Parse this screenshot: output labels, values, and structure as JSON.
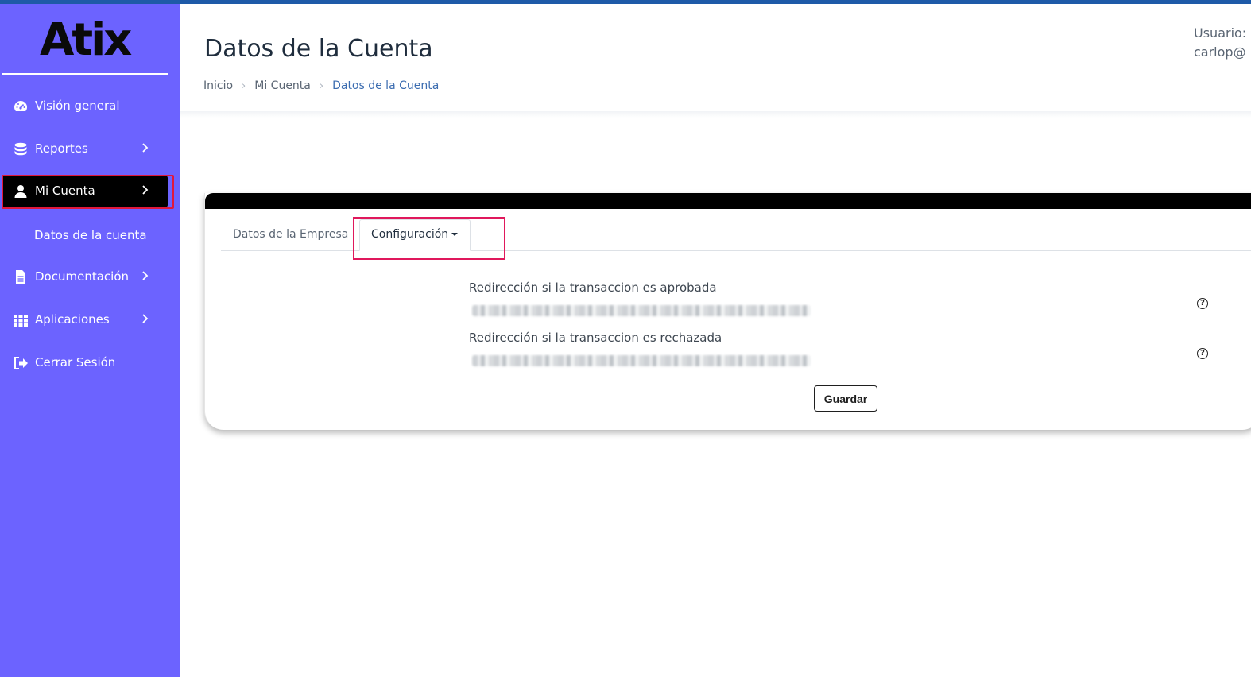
{
  "brand": {
    "logo": "Atix"
  },
  "sidebar": {
    "items": [
      {
        "label": "Visión general",
        "icon": "dashboard-icon"
      },
      {
        "label": "Reportes",
        "icon": "database-icon"
      },
      {
        "label": "Mi Cuenta",
        "icon": "user-icon"
      },
      {
        "label": "Datos de la cuenta"
      },
      {
        "label": "Documentación",
        "icon": "document-icon"
      },
      {
        "label": "Aplicaciones",
        "icon": "grid-icon"
      },
      {
        "label": "Cerrar Sesión",
        "icon": "sign-out-icon"
      }
    ]
  },
  "header": {
    "title": "Datos de la Cuenta",
    "breadcrumb": [
      "Inicio",
      "Mi Cuenta",
      "Datos de la Cuenta"
    ],
    "user_label": "Usuario:",
    "user_email": "carlop@"
  },
  "tabs": [
    {
      "label": "Datos de la Empresa"
    },
    {
      "label": "Configuración"
    }
  ],
  "form": {
    "approved_label": "Redirección si la transaccion es aprobada",
    "rejected_label": "Redirección si la transaccion es rechazada",
    "save_label": "Guardar"
  },
  "colors": {
    "sidebar_bg": "#6c63ff",
    "active_bg": "#000000",
    "highlight_outline": "#e0183c",
    "topbar": "#1e5aa8"
  }
}
